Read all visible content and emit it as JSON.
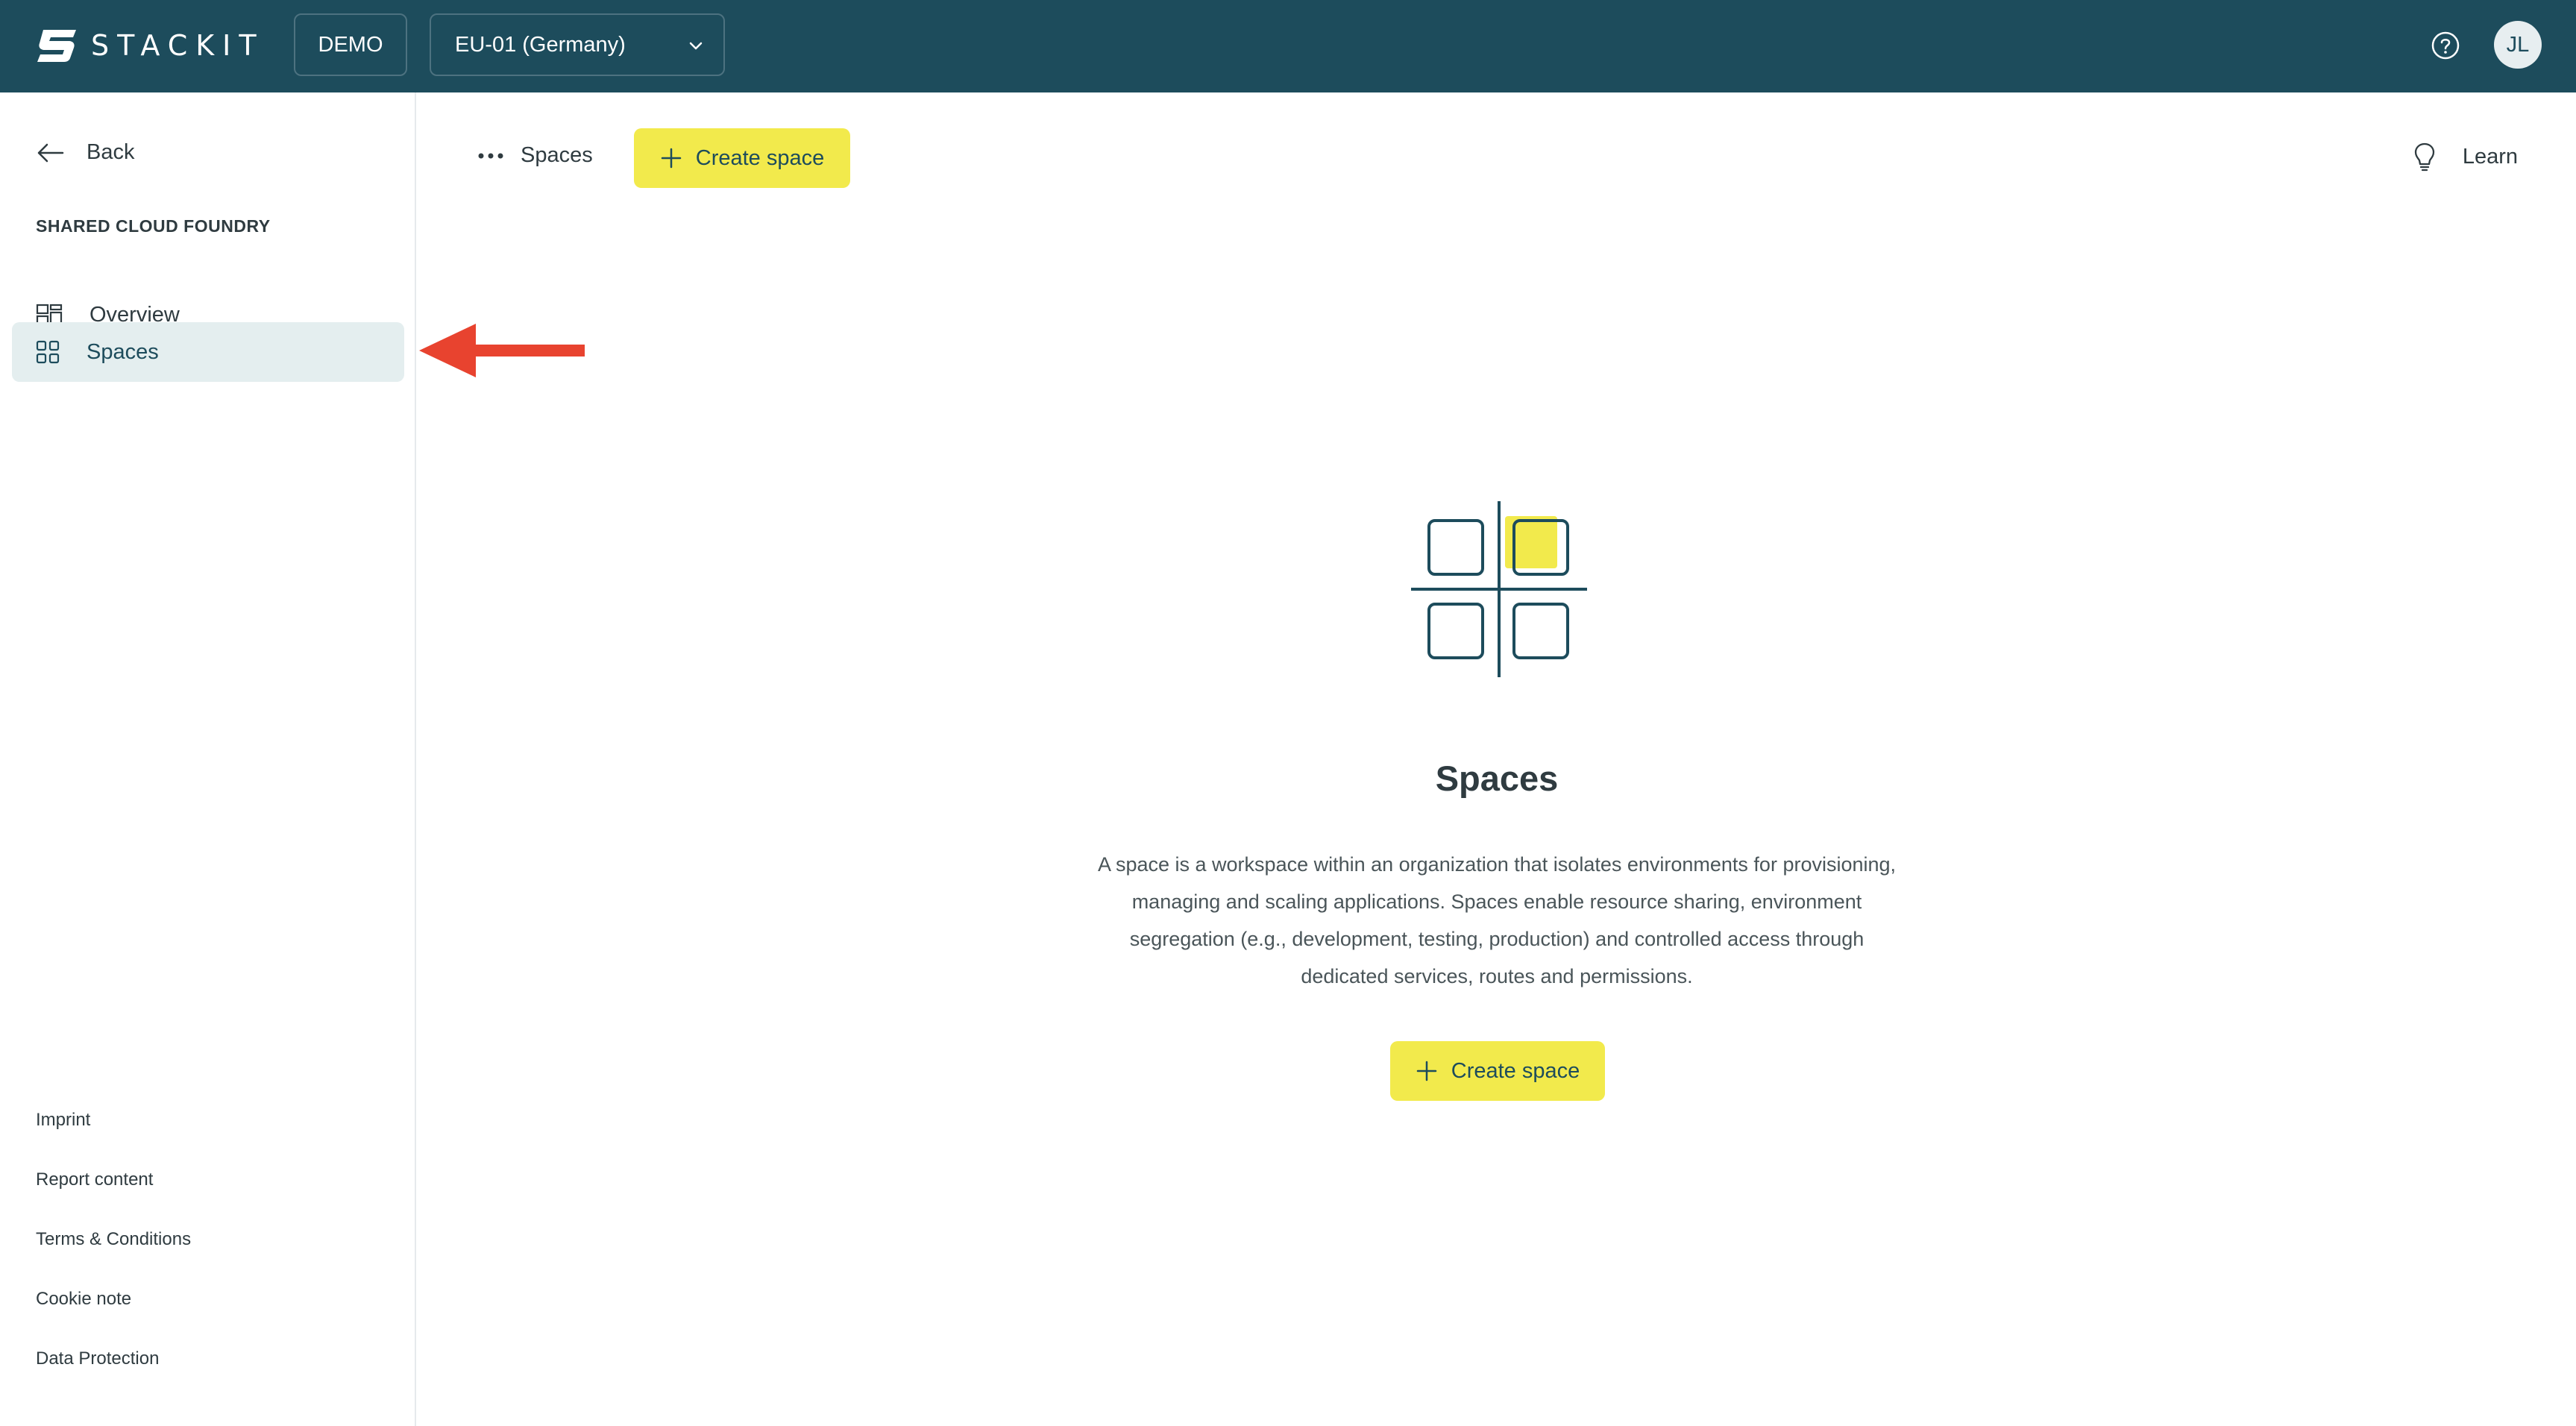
{
  "app": {
    "brand": "STACKIT",
    "environment": "DEMO",
    "region": "EU-01 (Germany)",
    "user_initials": "JL"
  },
  "sidebar": {
    "back_label": "Back",
    "section_title": "SHARED CLOUD FOUNDRY",
    "items": [
      {
        "label": "Overview",
        "icon": "dashboard-icon",
        "active": false
      },
      {
        "label": "Spaces",
        "icon": "spaces-grid-icon",
        "active": true
      }
    ],
    "footer_links": [
      "Imprint",
      "Report content",
      "Terms & Conditions",
      "Cookie note",
      "Data Protection"
    ]
  },
  "header": {
    "breadcrumb": "Spaces",
    "create_label": "Create space",
    "learn_label": "Learn"
  },
  "empty_state": {
    "title": "Spaces",
    "description": "A space is a workspace within an organization that isolates environments for provisioning, managing and scaling applications. Spaces enable resource sharing, environment segregation (e.g., development, testing, production) and controlled access through dedicated services, routes and permissions.",
    "create_label": "Create space"
  },
  "colors": {
    "topbar": "#1d4c5c",
    "accent_yellow": "#f2ea4c",
    "active_nav": "#e4eeef",
    "annotation_arrow": "#e8432f"
  }
}
